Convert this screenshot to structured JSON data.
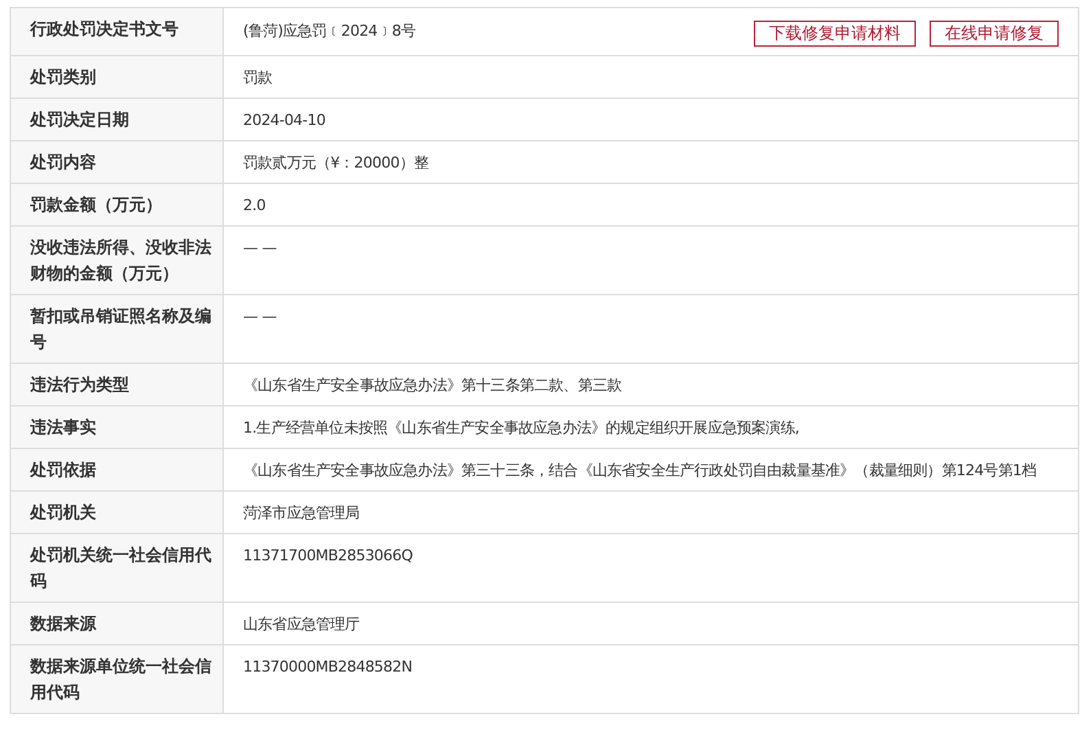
{
  "rows": [
    {
      "label": "行政处罚决定书文号",
      "value": "(鲁菏)应急罚﹝2024﹞8号",
      "actions": [
        "下载修复申请材料",
        "在线申请修复"
      ]
    },
    {
      "label": "处罚类别",
      "value": "罚款"
    },
    {
      "label": "处罚决定日期",
      "value": "2024-04-10"
    },
    {
      "label": "处罚内容",
      "value": "罚款贰万元（¥：20000）整"
    },
    {
      "label": "罚款金额（万元）",
      "value": "2.0"
    },
    {
      "label": "没收违法所得、没收非法财物的金额（万元）",
      "value": "— —"
    },
    {
      "label": "暂扣或吊销证照名称及编号",
      "value": "— —"
    },
    {
      "label": "违法行为类型",
      "value": "《山东省生产安全事故应急办法》第十三条第二款、第三款"
    },
    {
      "label": "违法事实",
      "value": "1.生产经营单位未按照《山东省生产安全事故应急办法》的规定组织开展应急预案演练,"
    },
    {
      "label": "处罚依据",
      "value": "《山东省生产安全事故应急办法》第三十三条，结合《山东省安全生产行政处罚自由裁量基准》（裁量细则）第124号第1档"
    },
    {
      "label": "处罚机关",
      "value": "菏泽市应急管理局"
    },
    {
      "label": "处罚机关统一社会信用代码",
      "value": "11371700MB2853066Q"
    },
    {
      "label": "数据来源",
      "value": "山东省应急管理厅"
    },
    {
      "label": "数据来源单位统一社会信用代码",
      "value": "11370000MB2848582N"
    }
  ]
}
